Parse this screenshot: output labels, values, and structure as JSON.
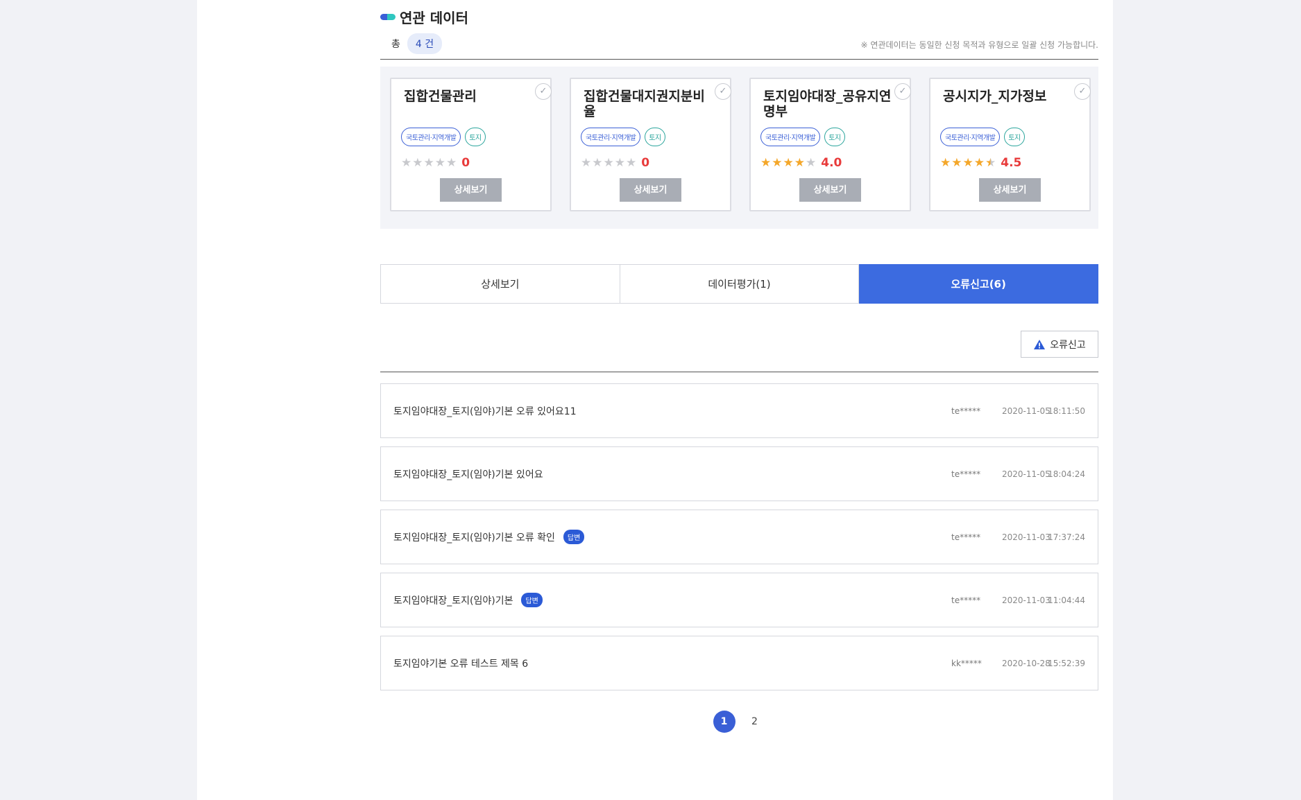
{
  "related": {
    "title": "연관 데이터",
    "total_label": "총",
    "total_count": "4 건",
    "notice": "※ 연관데이터는 동일한 신청 목적과 유형으로 일괄 신청 가능합니다.",
    "cards": [
      {
        "title": "집합건물관리",
        "tag1": "국토관리·지역개발",
        "tag2": "토지",
        "rating": 0,
        "score": "0",
        "button": "상세보기"
      },
      {
        "title": "집합건물대지권지분비율",
        "tag1": "국토관리·지역개발",
        "tag2": "토지",
        "rating": 0,
        "score": "0",
        "button": "상세보기"
      },
      {
        "title": "토지임야대장_공유지연명부",
        "tag1": "국토관리·지역개발",
        "tag2": "토지",
        "rating": 4.0,
        "score": "4.0",
        "button": "상세보기"
      },
      {
        "title": "공시지가_지가정보",
        "tag1": "국토관리·지역개발",
        "tag2": "토지",
        "rating": 4.5,
        "score": "4.5",
        "button": "상세보기"
      }
    ]
  },
  "tabs": [
    {
      "label": "상세보기",
      "active": false
    },
    {
      "label": "데이터평가(1)",
      "active": false
    },
    {
      "label": "오류신고(6)",
      "active": true
    }
  ],
  "report_button": {
    "label": "오류신고",
    "icon": "warning-icon"
  },
  "reports": [
    {
      "title": "토지임야대장_토지(임야)기본 오류 있어요11",
      "answered": false,
      "answer_label": "",
      "user": "te*****",
      "date": "2020-11-05",
      "time": "18:11:50"
    },
    {
      "title": "토지임야대장_토지(임야)기본 있어요",
      "answered": false,
      "answer_label": "",
      "user": "te*****",
      "date": "2020-11-05",
      "time": "18:04:24"
    },
    {
      "title": "토지임야대장_토지(임야)기본 오류 확인",
      "answered": true,
      "answer_label": "답변",
      "user": "te*****",
      "date": "2020-11-03",
      "time": "17:37:24"
    },
    {
      "title": "토지임야대장_토지(임야)기본",
      "answered": true,
      "answer_label": "답변",
      "user": "te*****",
      "date": "2020-11-03",
      "time": "11:04:44"
    },
    {
      "title": "토지임야기본 오류 테스트 제목 6",
      "answered": false,
      "answer_label": "",
      "user": "kk*****",
      "date": "2020-10-28",
      "time": "15:52:39"
    }
  ],
  "pagination": {
    "pages": [
      "1",
      "2"
    ],
    "current": "1"
  },
  "colors": {
    "accent": "#3c6be0",
    "rating_star": "#f4a72a",
    "score": "#e83b3b"
  }
}
